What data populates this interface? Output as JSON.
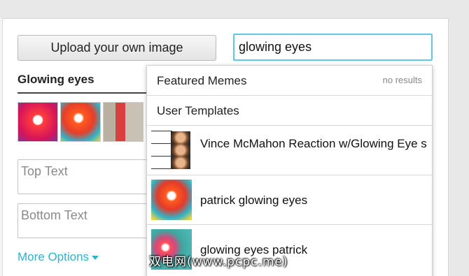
{
  "upload": {
    "label": "Upload your own image"
  },
  "search": {
    "value": "glowing eyes"
  },
  "meme": {
    "title": "Glowing eyes",
    "top_text_placeholder": "Top Text",
    "bottom_text_placeholder": "Bottom Text",
    "more_options": "More Options"
  },
  "dropdown": {
    "featured": {
      "label": "Featured Memes",
      "status": "no results"
    },
    "user_templates": {
      "label": "User Templates"
    },
    "items": [
      {
        "label": "Vince McMahon Reaction w/Glowing Eye s"
      },
      {
        "label": "patrick glowing eyes"
      },
      {
        "label": "glowing eyes patrick"
      }
    ]
  },
  "watermark": {
    "text": "双电网(www.pcpc.me)"
  },
  "colors": {
    "accent": "#2db3cf",
    "focus_border": "#5ecbdb"
  }
}
